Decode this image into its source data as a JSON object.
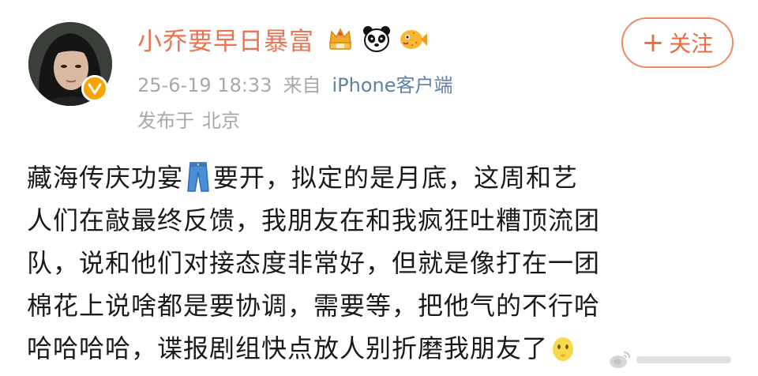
{
  "user": {
    "name": "小乔要早日暴富",
    "avatar_icon": "avatar-photo",
    "verified_icon": "verified-v-icon",
    "verified_color": "#f7a400",
    "badges": [
      "crown-badge-icon",
      "panda-icon",
      "pufferfish-icon"
    ]
  },
  "meta": {
    "timestamp": "25-6-19 18:33",
    "source_prefix": "来自",
    "source": "iPhone客户端",
    "location_prefix": "发布于",
    "location": "北京"
  },
  "follow": {
    "plus": "+",
    "label": "关注"
  },
  "post": {
    "lines": [
      "藏海传庆功宴",
      "要开，拟定的是月底，这周和艺",
      "人们在敲最终反馈，我朋友在和我疯狂吐糟顶流团",
      "队，说和他们对接态度非常好，但就是像打在一团",
      "棉花上说啥都是要协调，需要等，把他气的不行哈",
      "哈哈哈哈，谍报剧组快点放人别折磨我朋友了"
    ],
    "inline_icons": [
      "jeans-emoji",
      "yellow-face-emoji"
    ]
  },
  "colors": {
    "username": "#eb7350",
    "source_link": "#5d81a8",
    "meta": "#a8a8a8",
    "follow": "#e86c3e"
  },
  "watermark": {
    "icon": "weibo-logo-icon"
  }
}
